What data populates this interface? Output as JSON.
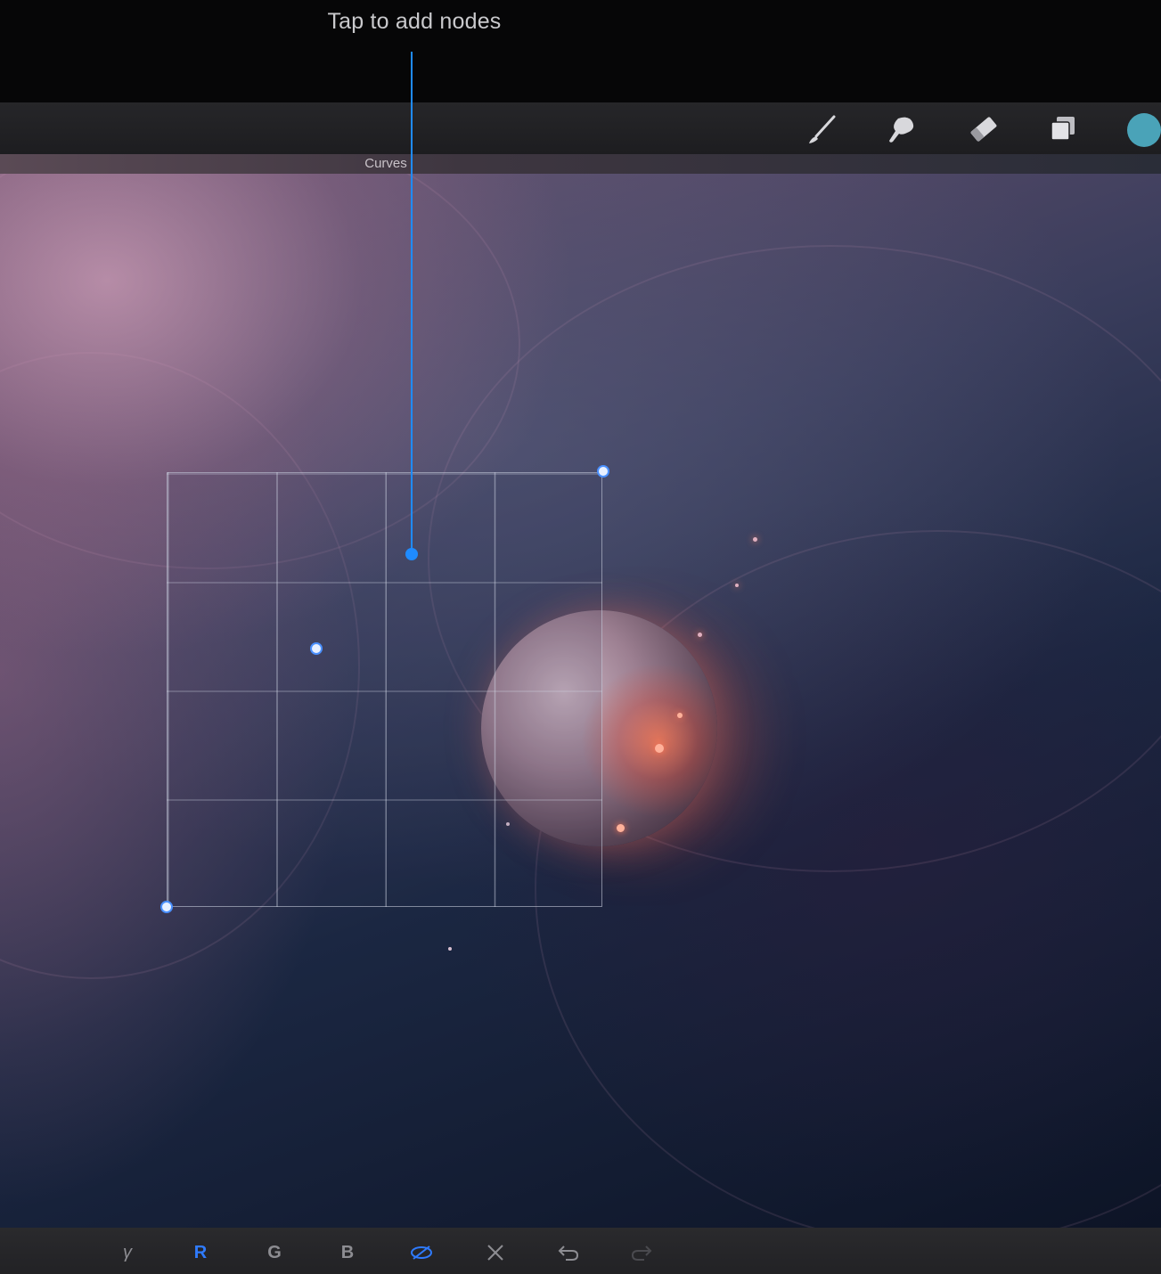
{
  "callout": {
    "text": "Tap to add nodes"
  },
  "toolbar": {
    "tools": [
      "paint-brush",
      "smudge",
      "eraser",
      "layers"
    ],
    "color": "#4aa3b8"
  },
  "panel": {
    "title": "Curves"
  },
  "bottom_bar": {
    "channels": [
      {
        "label": "γ",
        "active": false
      },
      {
        "label": "R",
        "active": true
      },
      {
        "label": "G",
        "active": false
      },
      {
        "label": "B",
        "active": false
      }
    ],
    "actions": [
      "eye-icon",
      "close-icon",
      "undo-icon",
      "redo-icon"
    ]
  },
  "colors": {
    "accent": "#1f8bff",
    "active_channel": "#2f7bff"
  }
}
